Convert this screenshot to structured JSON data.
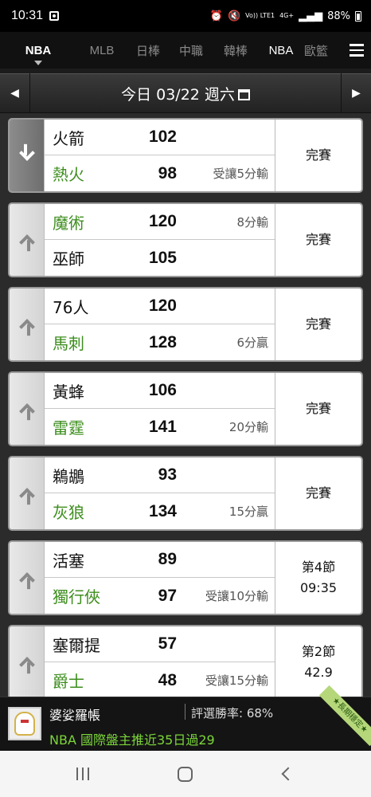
{
  "status_bar": {
    "time": "10:31",
    "network": "Vo)) LTE1",
    "network_type": "4G+",
    "battery": "88%"
  },
  "tabs": [
    {
      "label": "NBA",
      "active": true
    },
    {
      "label": "MLB",
      "active": false
    },
    {
      "label": "日棒",
      "active": false
    },
    {
      "label": "中職",
      "active": false
    },
    {
      "label": "韓棒",
      "active": false
    },
    {
      "label": "NBA",
      "active": false
    },
    {
      "label": "歐籃",
      "active": false
    }
  ],
  "date_bar": {
    "label": "今日 03/22 週六"
  },
  "games": [
    {
      "expanded": true,
      "team1": {
        "name": "火箭",
        "score": "102",
        "highlight": false,
        "handicap": ""
      },
      "team2": {
        "name": "熱火",
        "score": "98",
        "highlight": true,
        "handicap": "受讓5分輸"
      },
      "status": "完賽"
    },
    {
      "expanded": false,
      "team1": {
        "name": "魔術",
        "score": "120",
        "highlight": true,
        "handicap": "8分輸"
      },
      "team2": {
        "name": "巫師",
        "score": "105",
        "highlight": false,
        "handicap": ""
      },
      "status": "完賽"
    },
    {
      "expanded": false,
      "team1": {
        "name": "76人",
        "score": "120",
        "highlight": false,
        "handicap": ""
      },
      "team2": {
        "name": "馬刺",
        "score": "128",
        "highlight": true,
        "handicap": "6分贏"
      },
      "status": "完賽"
    },
    {
      "expanded": false,
      "team1": {
        "name": "黃蜂",
        "score": "106",
        "highlight": false,
        "handicap": ""
      },
      "team2": {
        "name": "雷霆",
        "score": "141",
        "highlight": true,
        "handicap": "20分輸"
      },
      "status": "完賽"
    },
    {
      "expanded": false,
      "team1": {
        "name": "鵜鶘",
        "score": "93",
        "highlight": false,
        "handicap": ""
      },
      "team2": {
        "name": "灰狼",
        "score": "134",
        "highlight": true,
        "handicap": "15分贏"
      },
      "status": "完賽"
    },
    {
      "expanded": false,
      "team1": {
        "name": "活塞",
        "score": "89",
        "highlight": false,
        "handicap": ""
      },
      "team2": {
        "name": "獨行俠",
        "score": "97",
        "highlight": true,
        "handicap": "受讓10分輸"
      },
      "status": "第4節\n09:35"
    },
    {
      "expanded": false,
      "team1": {
        "name": "塞爾提",
        "score": "57",
        "highlight": false,
        "handicap": ""
      },
      "team2": {
        "name": "爵士",
        "score": "48",
        "highlight": true,
        "handicap": "受讓15分輸"
      },
      "status": "第2節\n42.9"
    }
  ],
  "footer": {
    "name": "婆娑羅帳",
    "rate": "評選勝率: 68%",
    "promo": "NBA 國際盤主推近35日過29",
    "ribbon": "★長期穩定★"
  },
  "colors": {
    "highlight_green": "#3e8e1f",
    "promo_green": "#7bd63a"
  }
}
